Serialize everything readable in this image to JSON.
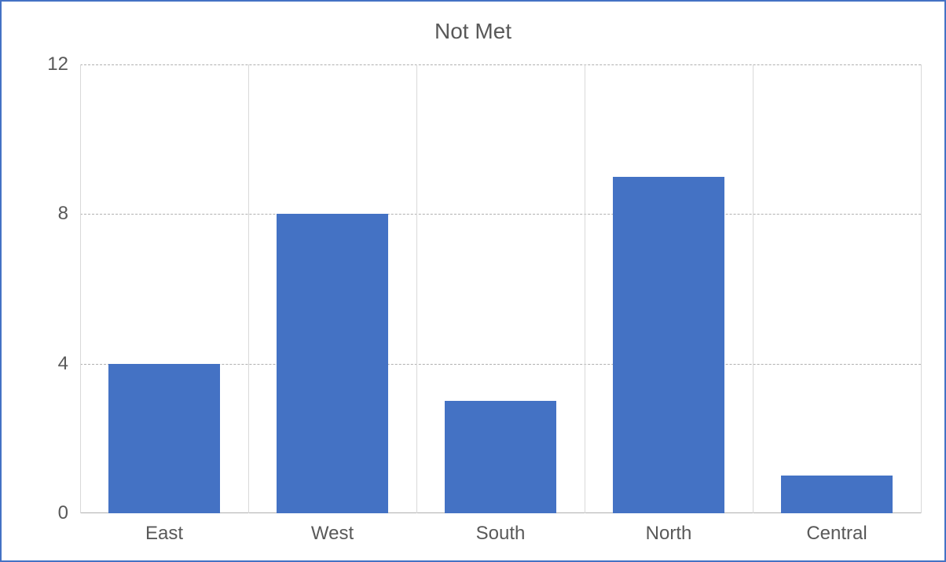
{
  "chart_data": {
    "type": "bar",
    "title": "Not Met",
    "categories": [
      "East",
      "West",
      "South",
      "North",
      "Central"
    ],
    "values": [
      4,
      8,
      3,
      9,
      1
    ],
    "xlabel": "",
    "ylabel": "",
    "ylim": [
      0,
      12
    ],
    "yticks": [
      0,
      4,
      8,
      12
    ],
    "bar_color": "#4472c4",
    "grid": true
  }
}
